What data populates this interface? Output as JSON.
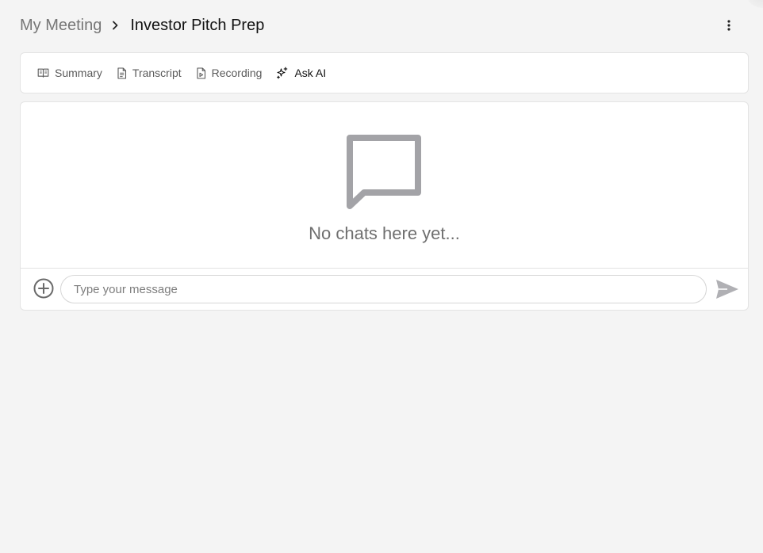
{
  "breadcrumb": {
    "root": "My Meeting",
    "current": "Investor Pitch Prep"
  },
  "tabs": [
    {
      "label": "Summary",
      "icon": "book-open-icon",
      "active": false
    },
    {
      "label": "Transcript",
      "icon": "document-text-icon",
      "active": false
    },
    {
      "label": "Recording",
      "icon": "document-play-icon",
      "active": false
    },
    {
      "label": "Ask AI",
      "icon": "sparkles-icon",
      "active": true
    }
  ],
  "chat": {
    "empty_text": "No chats here yet...",
    "empty_icon": "chat-bubble-icon"
  },
  "composer": {
    "placeholder": "Type your message",
    "value": ""
  },
  "colors": {
    "background": "#f4f4f4",
    "card": "#ffffff",
    "border": "#e3e3e3",
    "muted_icon": "#a3a3a7"
  }
}
